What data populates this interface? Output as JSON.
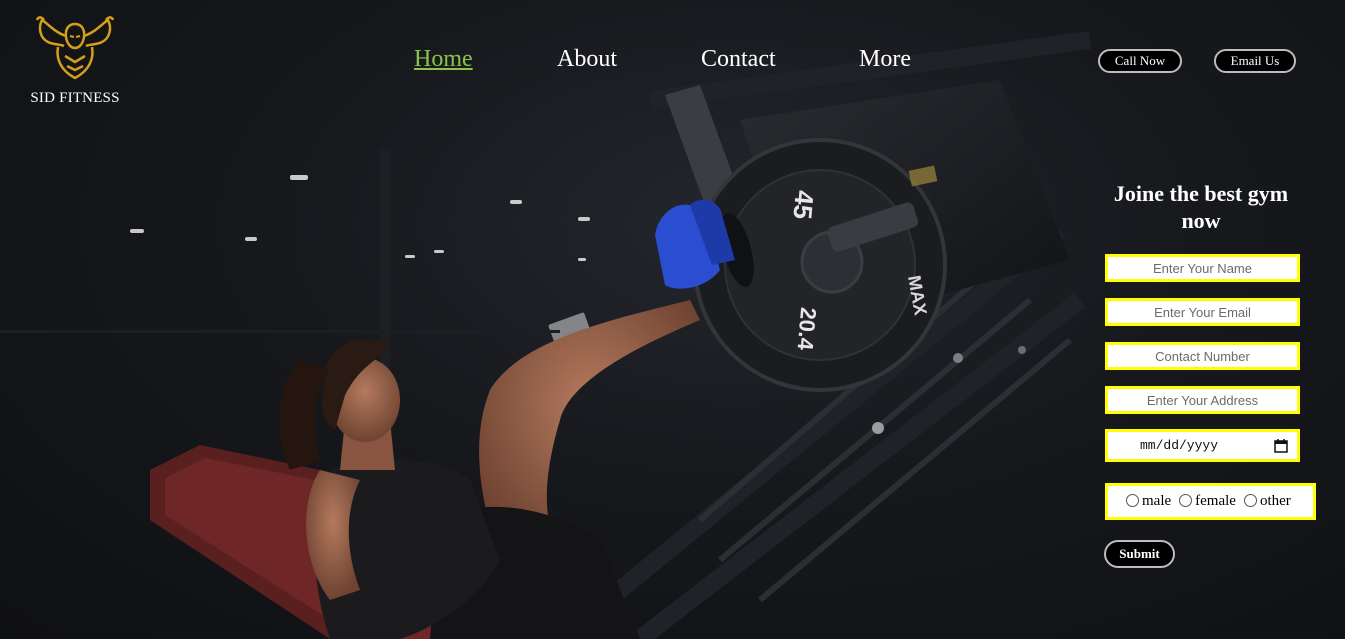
{
  "brand": {
    "name": "SID FITNESS",
    "logo_icon": "muscle-man-icon",
    "logo_color": "#d4a017"
  },
  "nav": {
    "items": [
      {
        "label": "Home",
        "active": true
      },
      {
        "label": "About",
        "active": false
      },
      {
        "label": "Contact",
        "active": false
      },
      {
        "label": "More",
        "active": false
      }
    ],
    "active_color": "#8bc34a"
  },
  "header_buttons": {
    "call": "Call Now",
    "email": "Email Us"
  },
  "form": {
    "title": "Joine the best gym now",
    "name_placeholder": "Enter Your Name",
    "email_placeholder": "Enter Your Email",
    "contact_placeholder": "Contact Number",
    "address_placeholder": "Enter Your Address",
    "date_placeholder": "mm/dd/yyyy",
    "gender_options": [
      "male",
      "female",
      "other"
    ],
    "submit_label": "Submit",
    "field_border_color": "#ffff00"
  },
  "scene": {
    "plate_top": "45",
    "plate_bottom": "20.4",
    "plate_brand": "MAX"
  }
}
